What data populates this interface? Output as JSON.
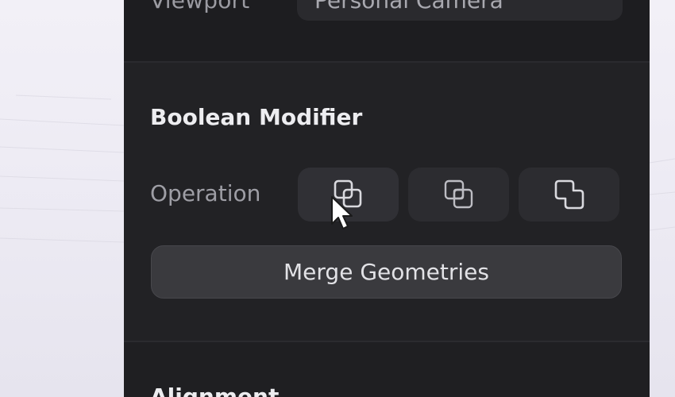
{
  "viewport": {
    "label": "Viewport",
    "value": "Personal Camera"
  },
  "boolean_modifier": {
    "title": "Boolean Modifier",
    "operation_label": "Operation",
    "operations": [
      {
        "icon": "union-icon",
        "state": "hovered"
      },
      {
        "icon": "intersect-icon",
        "state": "normal"
      },
      {
        "icon": "difference-icon",
        "state": "normal"
      }
    ],
    "merge_button": "Merge Geometries"
  },
  "alignment": {
    "title": "Alignment"
  },
  "colors": {
    "panel_bg": "#1f1f22",
    "section_bg": "#222225",
    "button_bg": "#2c2c30",
    "merge_button_bg": "#3a3a3e",
    "text_primary": "#ededf0",
    "text_secondary": "#9e9ea5",
    "canvas_bg": "#eeecf4"
  }
}
